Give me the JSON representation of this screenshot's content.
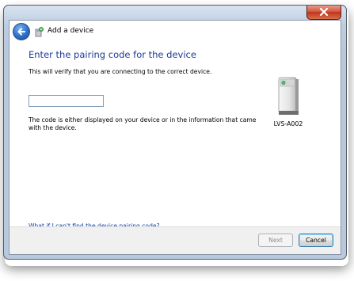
{
  "window": {
    "title": "Add a device",
    "close_icon": "close-icon",
    "back_icon": "back-arrow-icon"
  },
  "main": {
    "instruction": "Enter the pairing code for the device",
    "subtext": "This will verify that you are connecting to the correct device.",
    "code_input_value": "",
    "hint": "The code is either displayed on your device or in the information that came with the device.",
    "help_link": "What if I can't find the device pairing code?"
  },
  "device": {
    "name": "LVS-A002",
    "icon": "device-tower-icon"
  },
  "footer": {
    "next_label": "Next",
    "cancel_label": "Cancel"
  },
  "colors": {
    "instruction": "#1e3a99",
    "link": "#0b3ea8",
    "close_button": "#c0351c"
  }
}
